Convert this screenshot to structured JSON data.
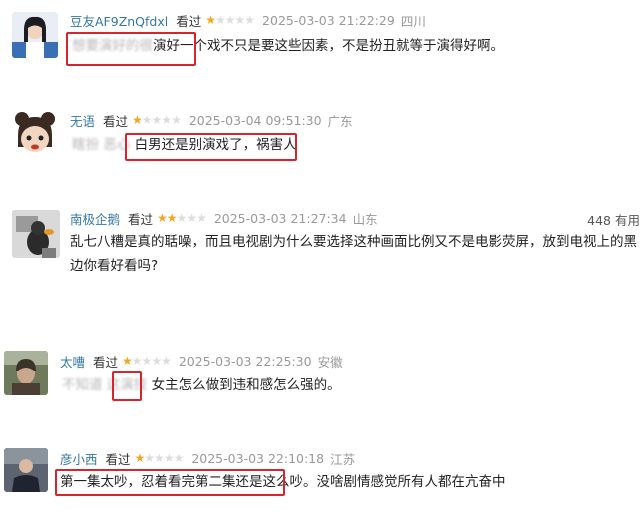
{
  "colors": {
    "username": "#3377aa",
    "star_filled": "#f5a623",
    "star_empty": "#dddddd",
    "highlight_box": "#d9232d"
  },
  "reviews": [
    {
      "username": "豆友AF9ZnQfdxl",
      "status": "看过",
      "rating": 1,
      "date": "2025-03-03 21:22:29",
      "location": "四川",
      "text_blurred": "想要演好的很",
      "text_visible": "演好一个戏不只是要这些因素，不是扮丑就等于演得好啊。"
    },
    {
      "username": "无语",
      "status": "看过",
      "rating": 1,
      "date": "2025-03-04 09:51:30",
      "location": "广东",
      "text_blurred": "瞎扮 恶心",
      "text_visible": "白男还是别演戏了，祸害人"
    },
    {
      "username": "南极企鹅",
      "status": "看过",
      "rating": 2,
      "date": "2025-03-03 21:27:34",
      "location": "山东",
      "votes": "448 有用",
      "text_visible": "乱七八糟是真的聒噪，而且电视剧为什么要选择这种画面比例又不是电影荧屏，放到电视上的黑边你看好看吗?"
    },
    {
      "username": "太嘈",
      "status": "看过",
      "rating": 1,
      "date": "2025-03-03 22:25:30",
      "location": "安徽",
      "text_blurred": "不知道 这演技",
      "text_visible": "女主怎么做到违和感怎么强的。"
    },
    {
      "username": "彦小西",
      "status": "看过",
      "rating": 1,
      "date": "2025-03-03 22:10:18",
      "location": "江苏",
      "text_boxed": "第一集太吵，忍着看完第二集还是这么吵。",
      "text_visible": "没啥剧情感觉所有人都在亢奋中"
    }
  ]
}
